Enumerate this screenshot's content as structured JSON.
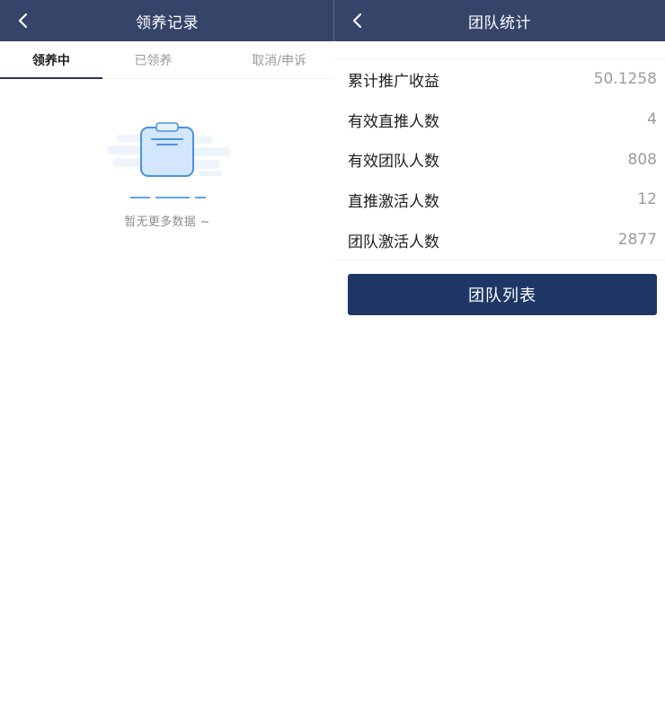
{
  "left": {
    "title": "领养记录",
    "tabs": [
      {
        "label": "领养中",
        "active": true
      },
      {
        "label": "已领养",
        "active": false
      },
      {
        "label": "取消/申诉",
        "active": false
      }
    ],
    "empty_text": "暂无更多数据 ~"
  },
  "right": {
    "title": "团队统计",
    "stats": [
      {
        "label": "累计推广收益",
        "value": "50.1258"
      },
      {
        "label": "有效直推人数",
        "value": "4"
      },
      {
        "label": "有效团队人数",
        "value": "808"
      },
      {
        "label": "直推激活人数",
        "value": "12"
      },
      {
        "label": "团队激活人数",
        "value": "2877"
      }
    ],
    "button_label": "团队列表"
  },
  "colors": {
    "navbar": "#354469",
    "button": "#1e3766",
    "active_tab_indicator": "#2b3a5a",
    "muted_text": "#9b9b9b"
  },
  "icons": {
    "back": "chevron-left-icon",
    "empty": "clipboard-empty-icon"
  }
}
